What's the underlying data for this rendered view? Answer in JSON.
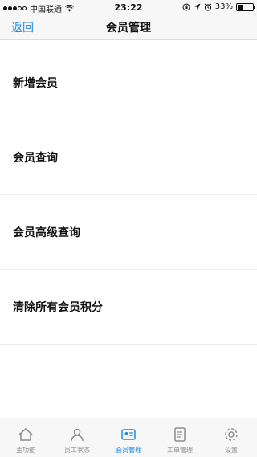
{
  "status_bar": {
    "carrier": "中国联通",
    "time": "23:22",
    "battery_percent": "33%",
    "battery_level": 0.33
  },
  "nav": {
    "back_label": "返回",
    "title": "会员管理"
  },
  "menu": {
    "items": [
      {
        "label": "新增会员"
      },
      {
        "label": "会员查询"
      },
      {
        "label": "会员高级查询"
      },
      {
        "label": "清除所有会员积分"
      },
      {
        "label": ""
      }
    ]
  },
  "tabbar": {
    "tabs": [
      {
        "label": "主功能",
        "icon": "home-icon"
      },
      {
        "label": "员工状态",
        "icon": "staff-icon"
      },
      {
        "label": "会员管理",
        "icon": "member-icon",
        "active": true
      },
      {
        "label": "工单管理",
        "icon": "ticket-icon"
      },
      {
        "label": "设置",
        "icon": "gear-icon"
      }
    ]
  },
  "colors": {
    "accent": "#1f8ae0",
    "inactive": "#8e8e93",
    "bar_bg": "#f7f7f7"
  }
}
